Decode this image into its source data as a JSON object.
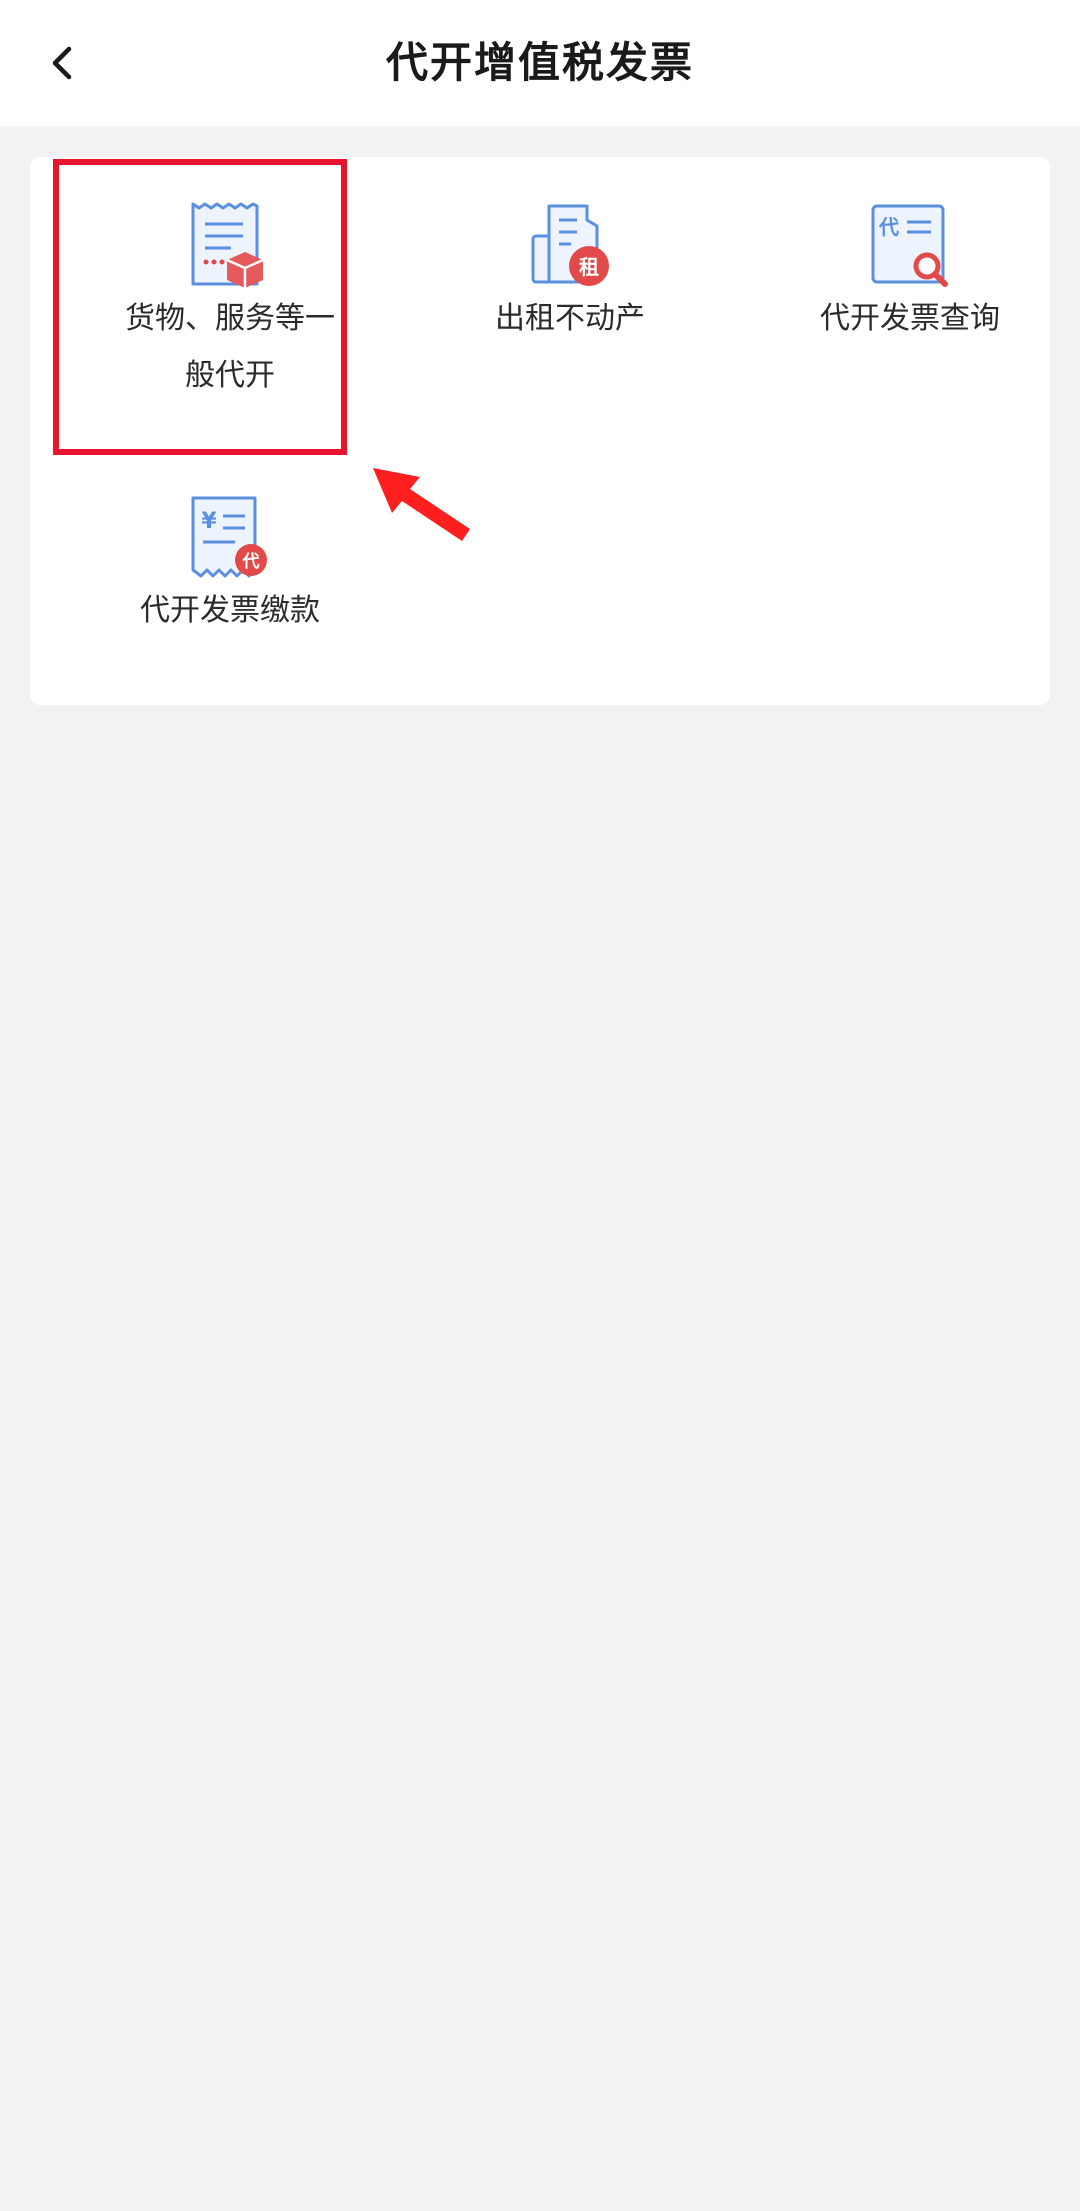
{
  "header": {
    "title": "代开增值税发票",
    "back_icon": "chevron-left-icon"
  },
  "services": [
    {
      "label": "货物、服务等一般代开",
      "icon": "invoice-package-icon"
    },
    {
      "label": "出租不动产",
      "icon": "building-rent-icon"
    },
    {
      "label": "代开发票查询",
      "icon": "invoice-search-icon"
    },
    {
      "label": "代开发票缴款",
      "icon": "invoice-payment-icon"
    }
  ],
  "colors": {
    "accent_blue": "#5b8fe0",
    "badge_red": "#e24a4a",
    "highlight_red": "#e8132e"
  }
}
